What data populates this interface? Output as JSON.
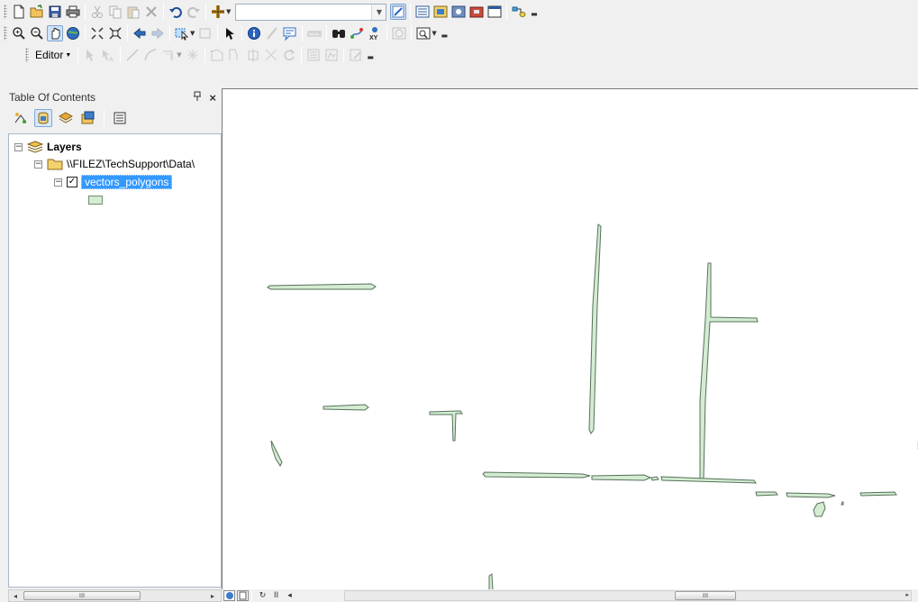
{
  "toolbars": {
    "standard": {
      "scale_value": "",
      "icons": [
        "new-document-icon",
        "open-icon",
        "save-icon",
        "print-icon",
        "cut-icon",
        "copy-icon",
        "paste-icon",
        "delete-icon",
        "undo-icon",
        "redo-icon",
        "add-data-icon",
        "editor-toolbar-icon",
        "table-of-contents-icon",
        "catalog-icon",
        "search-window-icon",
        "arctoolbox-icon",
        "python-window-icon",
        "model-builder-icon"
      ]
    },
    "tools": {
      "icons": [
        "zoom-in-icon",
        "zoom-out-icon",
        "pan-icon",
        "full-extent-icon",
        "fixed-zoom-in-icon",
        "fixed-zoom-out-icon",
        "back-icon",
        "forward-icon",
        "select-features-icon",
        "clear-selection-icon",
        "select-elements-icon",
        "identify-icon",
        "hyperlink-icon",
        "html-popup-icon",
        "measure-icon",
        "find-icon",
        "find-route-icon",
        "go-to-xy-icon",
        "time-slider-icon",
        "create-viewer-window-icon"
      ]
    },
    "editor": {
      "menu_label": "Editor"
    }
  },
  "toc": {
    "title": "Table Of Contents",
    "pin_glyph": "ɨ",
    "close_glyph": "×",
    "tools": [
      "list-by-drawing-order-icon",
      "list-by-source-icon",
      "list-by-visibility-icon",
      "list-by-selection-icon",
      "options-icon"
    ],
    "tree": {
      "root_label": "Layers",
      "folder_label": "\\\\FILEZ\\TechSupport\\Data\\",
      "layer_label": "vectors_polygons",
      "layer_checked": true,
      "symbol_fill": "#d3ecd2",
      "symbol_outline": "#6f8f6f"
    }
  },
  "scroll": {
    "thumb_grip": "III",
    "left_arrow": "◂",
    "right_arrow": "▸"
  },
  "map": {
    "background": "#ffffff",
    "feature_fill": "#d3ecd2",
    "feature_outline": "#56705a"
  },
  "map_controls": {
    "refresh_glyph": "↻",
    "pause_glyph": "II",
    "back_glyph": "◂"
  }
}
